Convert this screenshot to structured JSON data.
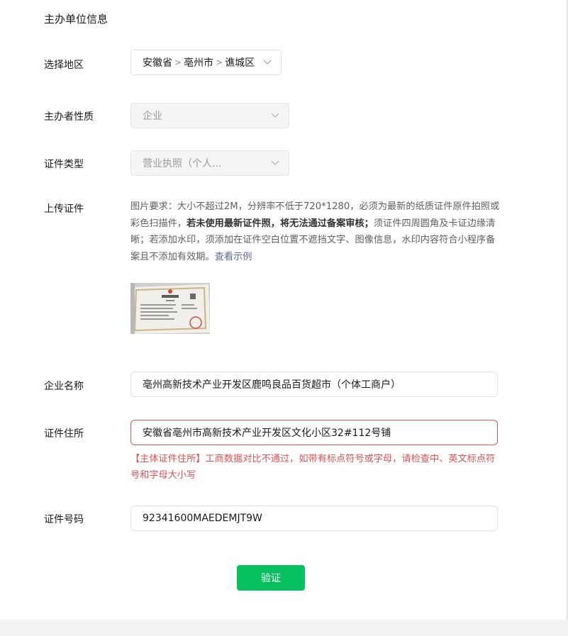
{
  "section_title": "主办单位信息",
  "region": {
    "label": "选择地区",
    "province": "安徽省",
    "city": "亳州市",
    "district": "谯城区",
    "separator": ">"
  },
  "organizer_type": {
    "label": "主办者性质",
    "value": "企业"
  },
  "cert_type": {
    "label": "证件类型",
    "value": "营业执照（个人..."
  },
  "upload": {
    "label": "上传证件",
    "note_part1": "图片要求：大小不超过2M，分辨率不低于720*1280，必须为最新的纸质证件原件拍照或彩色扫描件，",
    "note_bold": "若未使用最新证件照，将无法通过备案审核；",
    "note_part2": "须证件四周圆角及卡证边缘清晰；若添加水印，须添加在证件空白位置不遮挡文字、图像信息，水印内容符合小程序备案且不添加有效期。",
    "example_link": "查看示例"
  },
  "company_name": {
    "label": "企业名称",
    "value": "亳州高新技术产业开发区鹿鸣良品百货超市（个体工商户）"
  },
  "cert_address": {
    "label": "证件住所",
    "value": "安徽省亳州市高新技术产业开发区文化小区32#112号铺",
    "error": "【主体证件住所】工商数据对比不通过，如带有标点符号或字母，请检查中、英文标点符号和字母大小写"
  },
  "cert_number": {
    "label": "证件号码",
    "value": "92341600MAEDEMJT9W"
  },
  "verify_button": "验证",
  "colors": {
    "primary": "#07c160",
    "error": "#e05353",
    "link": "#576b95"
  }
}
